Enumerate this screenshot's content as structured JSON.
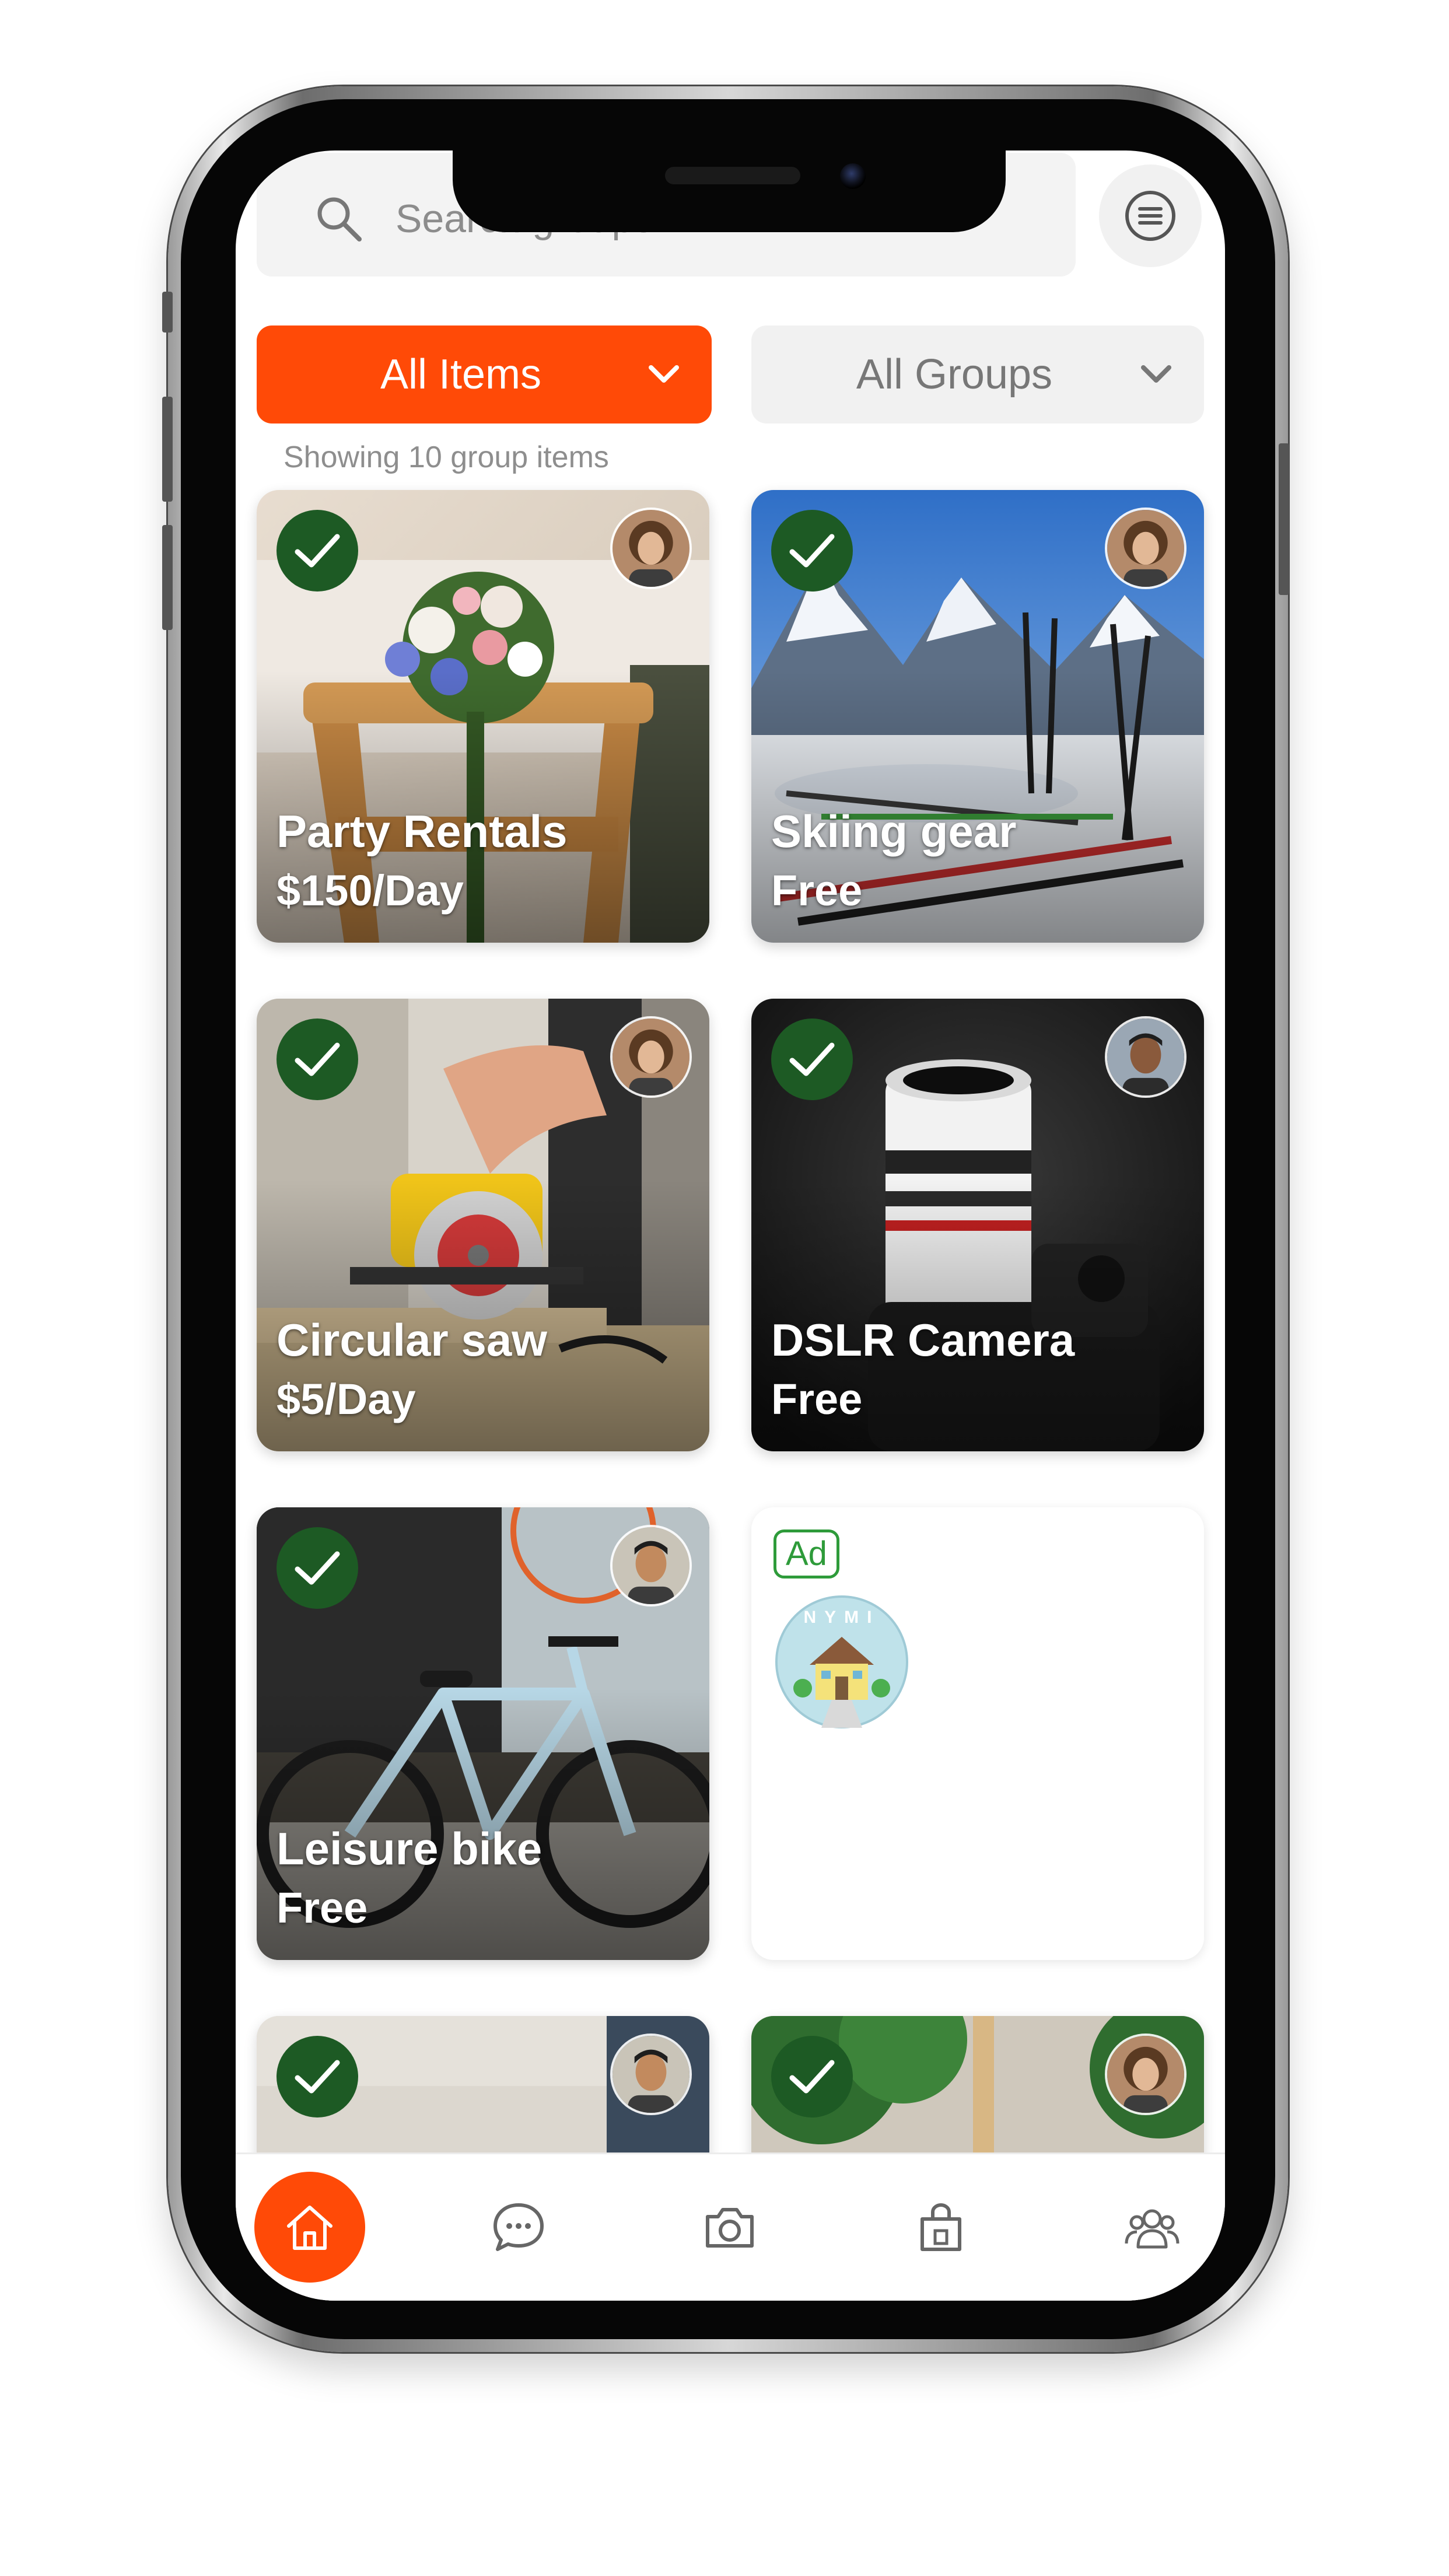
{
  "search": {
    "placeholder": "Search groups"
  },
  "filters": {
    "items_label": "All Items",
    "groups_label": "All Groups"
  },
  "results": {
    "summary": "Showing 10 group items"
  },
  "cards": [
    {
      "title": "Party Rentals",
      "price": "$150/Day",
      "checked": true,
      "owner": "woman-avatar"
    },
    {
      "title": "Skiing gear",
      "price": "Free",
      "checked": true,
      "owner": "woman-avatar"
    },
    {
      "title": "Circular saw",
      "price": "$5/Day",
      "checked": true,
      "owner": "woman-avatar"
    },
    {
      "title": "DSLR Camera",
      "price": "Free",
      "checked": true,
      "owner": "man-avatar"
    },
    {
      "title": "Leisure bike",
      "price": "Free",
      "checked": true,
      "owner": "man-avatar"
    },
    {
      "title": "",
      "price": "",
      "checked": true,
      "owner": "man-avatar"
    },
    {
      "title": "",
      "price": "",
      "checked": true,
      "owner": "woman-avatar"
    }
  ],
  "ad": {
    "badge": "Ad",
    "logo_text": "NYMI"
  },
  "nav": {
    "items": [
      "home-icon",
      "chat-icon",
      "camera-icon",
      "shopping-bag-icon",
      "people-icon"
    ],
    "active": "home-icon"
  },
  "colors": {
    "accent": "#ff4a07",
    "check": "#1d5a24",
    "ad_green": "#2e9b3a"
  }
}
